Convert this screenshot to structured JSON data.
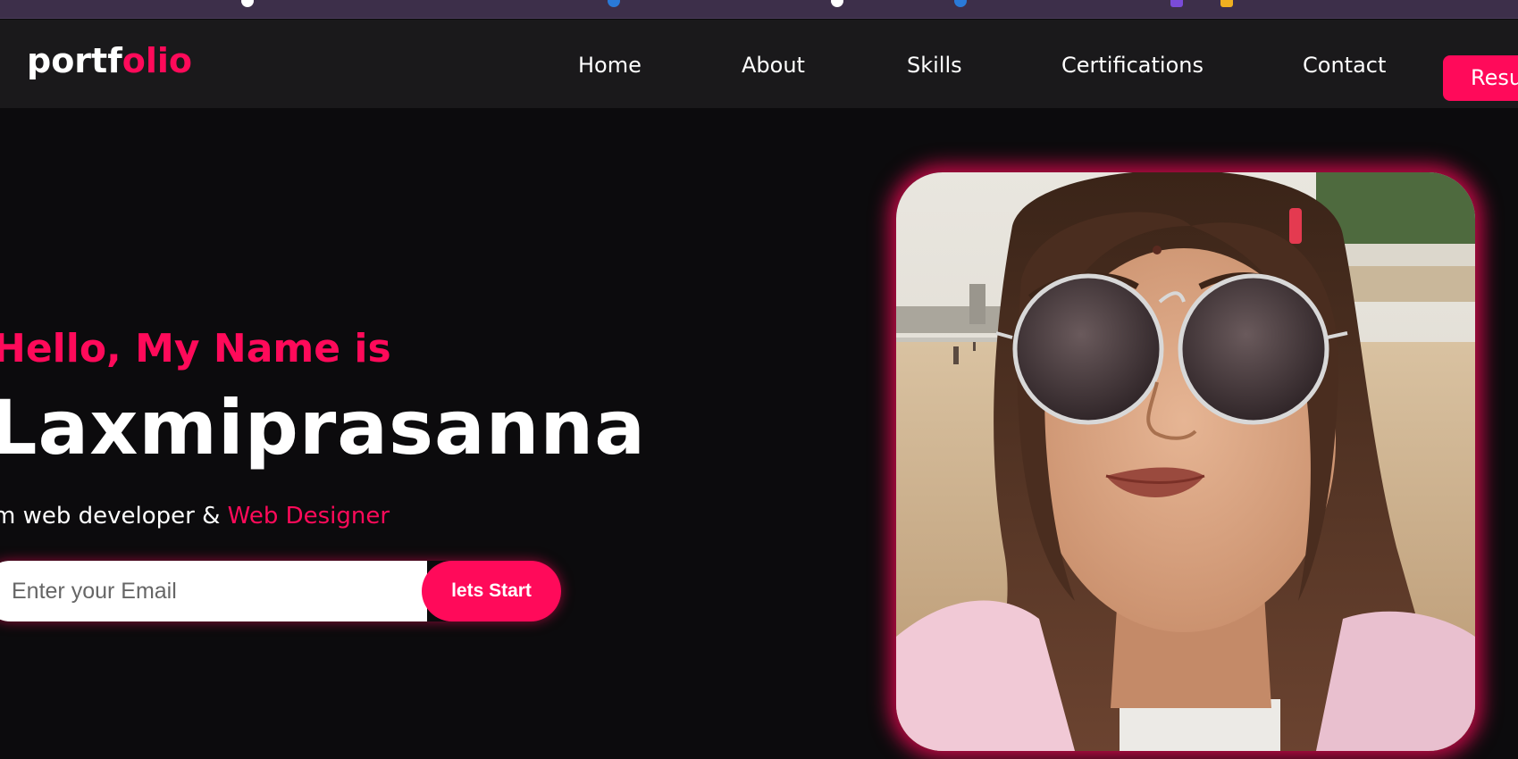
{
  "browser": {
    "strip_icon_colors": [
      "#ffffff",
      "#2a7ad8",
      "#ffffff",
      "#2a7ad8",
      "#7a4bd8",
      "#f0b020"
    ]
  },
  "brand": {
    "logo_part1": "portf",
    "logo_part2": "olio",
    "accent_color": "#ff0a5a"
  },
  "nav": {
    "items": [
      {
        "label": "Home"
      },
      {
        "label": "About"
      },
      {
        "label": "Skills"
      },
      {
        "label": "Certifications"
      },
      {
        "label": "Contact"
      }
    ],
    "resume_label": "Resu"
  },
  "hero": {
    "greeting": "Hello, My Name is",
    "name": "Laxmiprasanna",
    "role_prefix": "m web developer & ",
    "role_highlight": "Web Designer",
    "email_placeholder": "Enter your Email",
    "start_label": "lets Start"
  },
  "profile_image": {
    "alt": "profile-photo"
  }
}
